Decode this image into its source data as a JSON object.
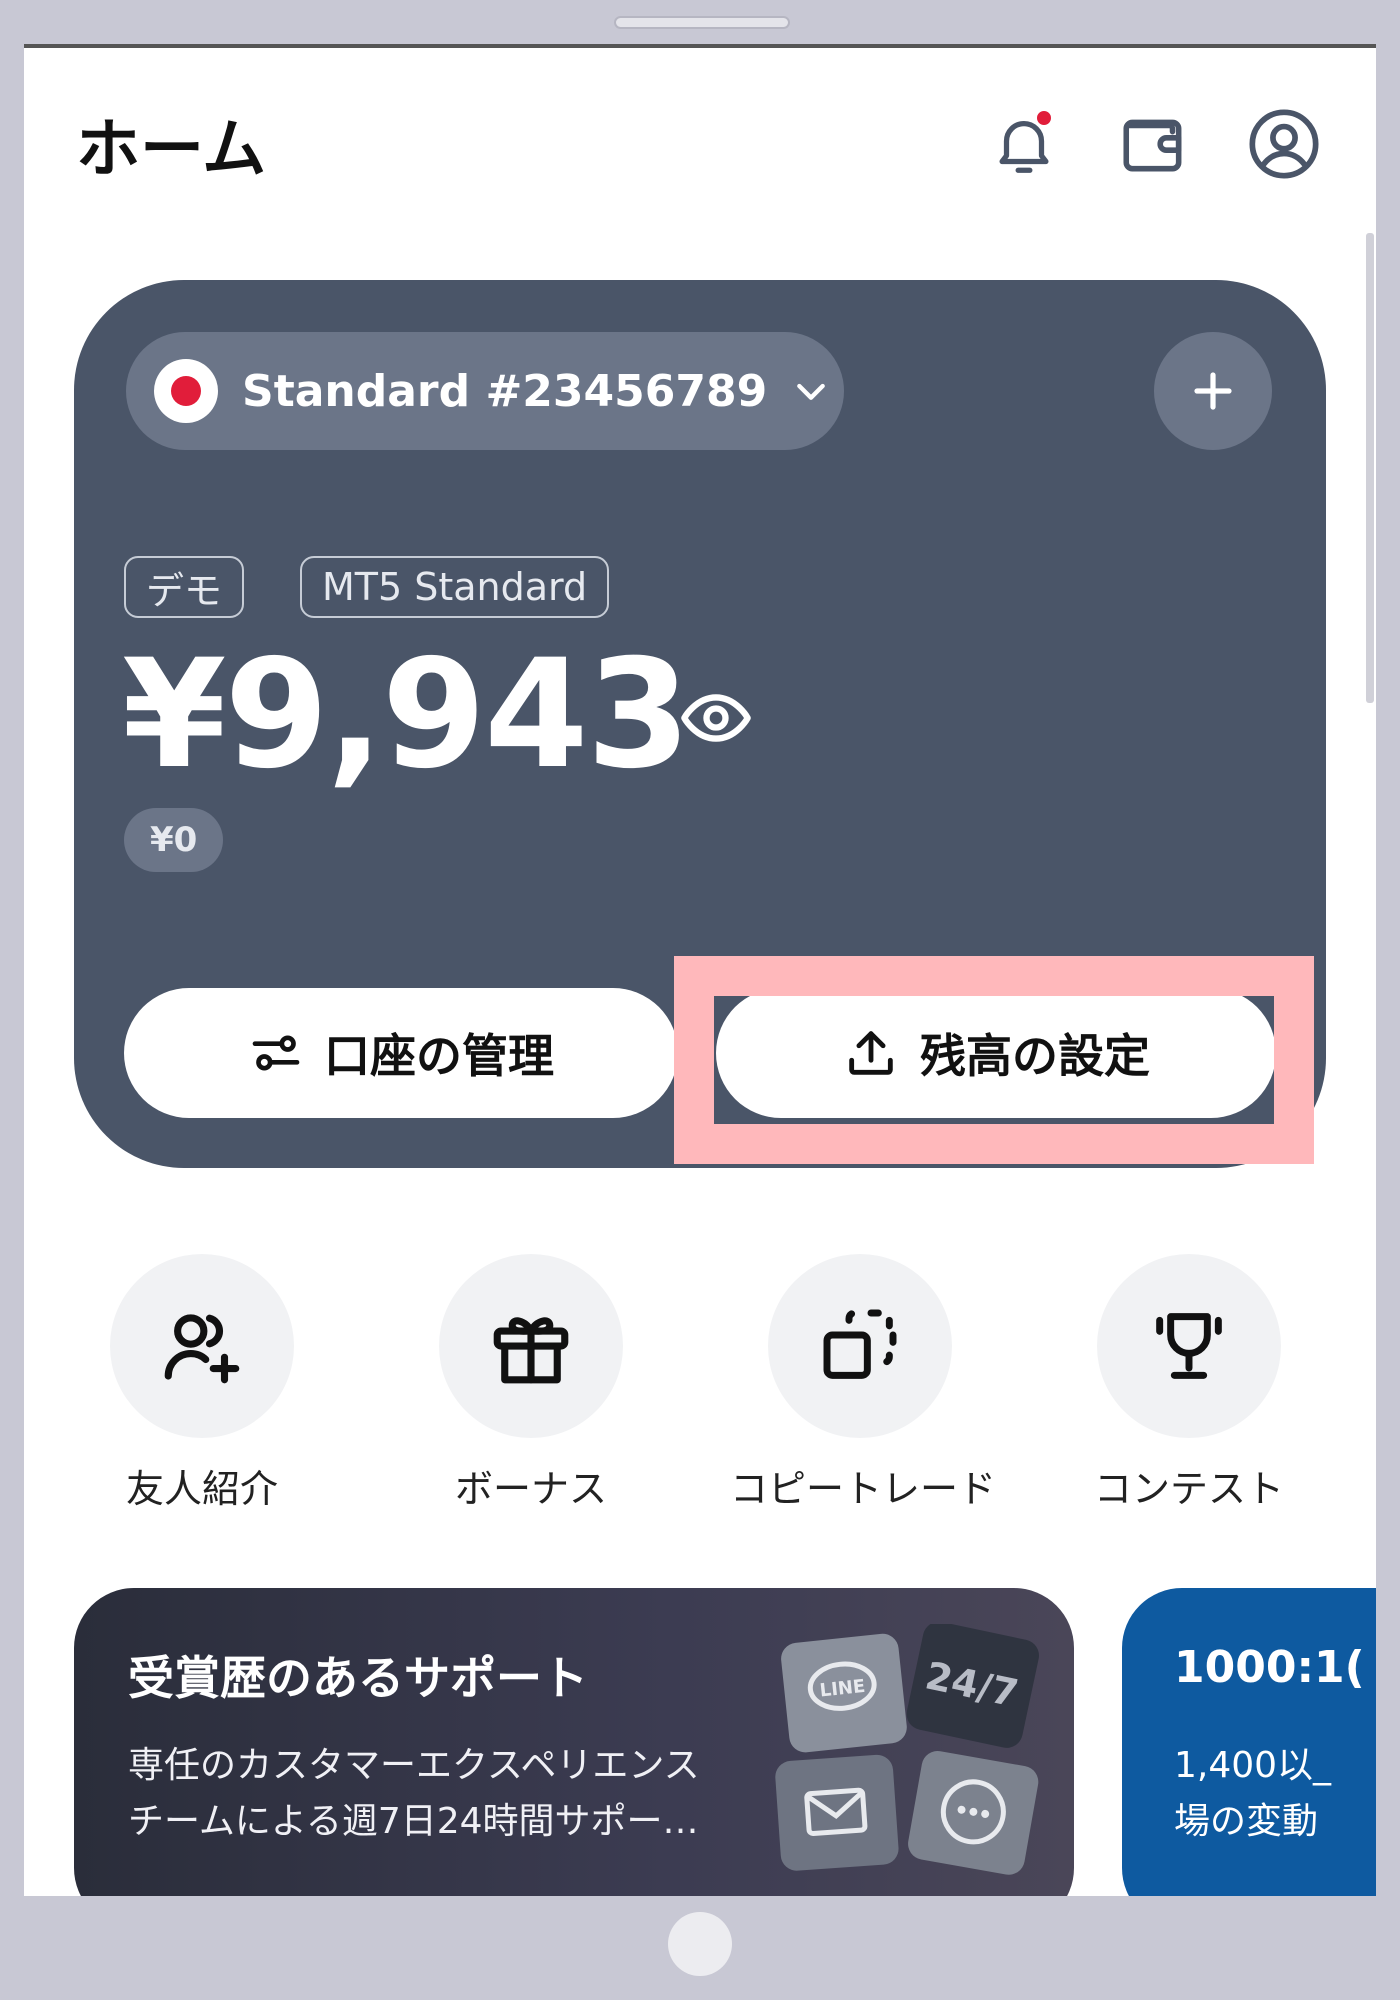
{
  "header": {
    "title": "ホーム"
  },
  "account": {
    "name": "Standard #23456789",
    "tag_mode": "デモ",
    "tag_type": "MT5 Standard",
    "balance": "¥9,943",
    "sub_balance": "¥0"
  },
  "actions": {
    "manage_label": "口座の管理",
    "set_balance_label": "残高の設定"
  },
  "quick_actions": [
    {
      "label": "友人紹介",
      "icon": "add-user-icon"
    },
    {
      "label": "ボーナス",
      "icon": "gift-icon"
    },
    {
      "label": "コピートレード",
      "icon": "copy-icon"
    },
    {
      "label": "コンテスト",
      "icon": "trophy-icon"
    }
  ],
  "promos": [
    {
      "title": "受賞歴のあるサポート",
      "body_line1": "専任のカスタマーエクスペリエンス",
      "body_line2": "チームによる週7日24時間サポー…"
    },
    {
      "title": "1000:1(",
      "body_line1": "1,400以_",
      "body_line2": "場の変動"
    }
  ],
  "promo_art": {
    "line_label": "LINE",
    "hours_label": "24/7"
  },
  "colors": {
    "card": "#4a5568",
    "pill": "#6b7588",
    "highlight": "#ffb8bb",
    "notification_dot": "#e11d3a",
    "promo_blue": "#0e5aa0"
  }
}
